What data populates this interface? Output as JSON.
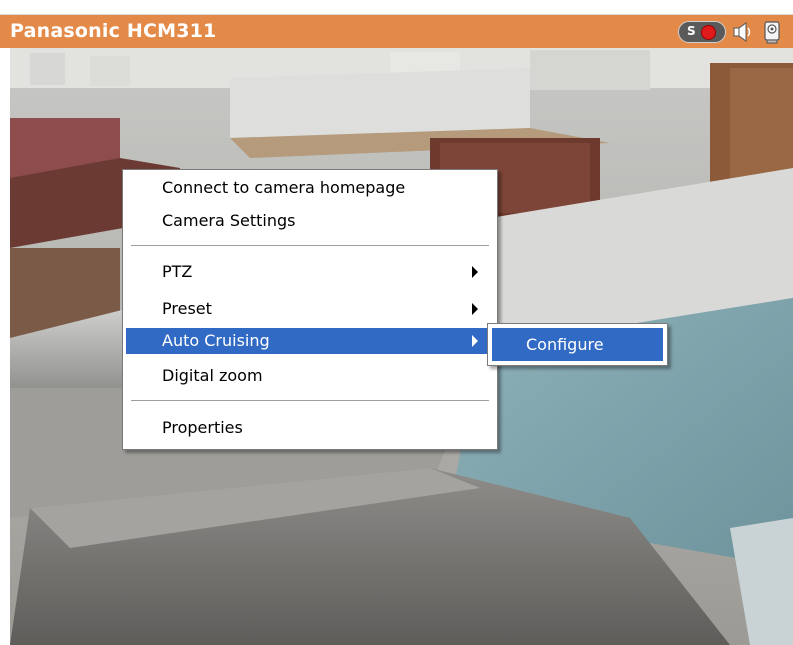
{
  "window": {
    "title": "Panasonic HCM311"
  },
  "toolbar": {
    "icons": [
      "record-icon",
      "speaker-icon",
      "camera-icon"
    ],
    "record_badge": "S"
  },
  "context_menu": {
    "items": [
      {
        "label": "Connect to camera homepage",
        "submenu": false,
        "highlighted": false
      },
      {
        "label": "Camera Settings",
        "submenu": false,
        "highlighted": false
      },
      {
        "label": "PTZ",
        "submenu": true,
        "highlighted": false
      },
      {
        "label": "Preset",
        "submenu": true,
        "highlighted": false
      },
      {
        "label": "Auto Cruising",
        "submenu": true,
        "highlighted": true
      },
      {
        "label": "Digital zoom",
        "submenu": false,
        "highlighted": false
      },
      {
        "label": "Properties",
        "submenu": false,
        "highlighted": false
      }
    ]
  },
  "submenu": {
    "items": [
      {
        "label": "Configure",
        "highlighted": true
      }
    ]
  },
  "colors": {
    "titlebar": "#e48a49",
    "highlight": "#316ac5"
  }
}
